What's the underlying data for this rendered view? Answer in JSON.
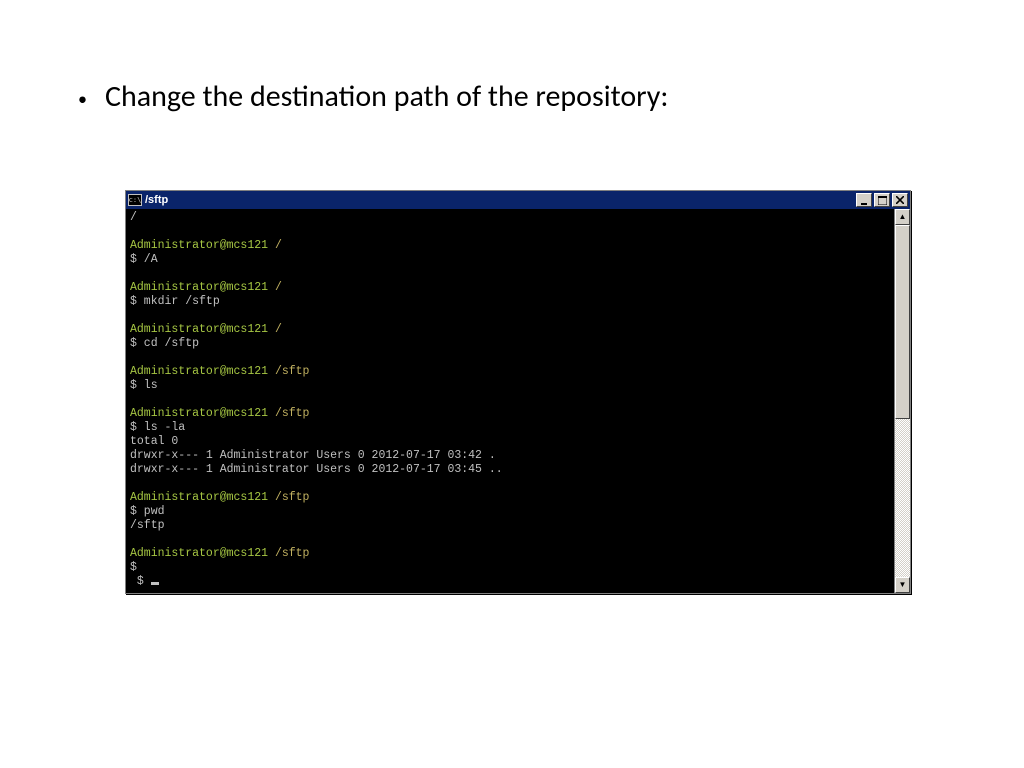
{
  "slide": {
    "bullet": "Change the destination path of the repository:"
  },
  "window": {
    "icon_text": "c:\\",
    "title": "/sftp",
    "buttons": {
      "min": "_",
      "max": "❐",
      "close": "✕"
    }
  },
  "term": {
    "root_slash": "/",
    "prompts": {
      "p1_user": "Administrator@mcs121 ",
      "p1_path": "/",
      "p2_user": "Administrator@mcs121 ",
      "p2_path": "/",
      "p3_user": "Administrator@mcs121 ",
      "p3_path": "/",
      "p4_user": "Administrator@mcs121 ",
      "p4_path": "/sftp",
      "p5_user": "Administrator@mcs121 ",
      "p5_path": "/sftp",
      "p6_user": "Administrator@mcs121 ",
      "p6_path": "/sftp",
      "p7_user": "Administrator@mcs121 ",
      "p7_path": "/sftp"
    },
    "cmd1": "$ /A",
    "cmd2": "$ mkdir /sftp",
    "cmd3": "$ cd /sftp",
    "cmd4": "$ ls",
    "cmd5": "$ ls -la",
    "out_total": "total 0",
    "out_l1": "drwxr-x--- 1 Administrator Users 0 2012-07-17 03:42 .",
    "out_l2": "drwxr-x--- 1 Administrator Users 0 2012-07-17 03:45 ..",
    "cmd6": "$ pwd",
    "out_pwd": "/sftp",
    "cmd7": "$",
    "cmd8_prefix": " $ "
  }
}
